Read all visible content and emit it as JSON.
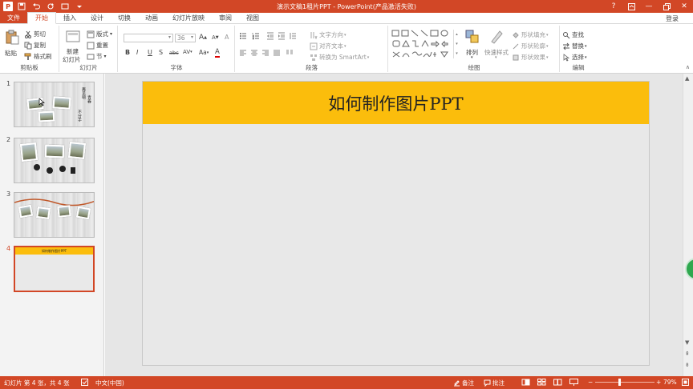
{
  "window": {
    "title": "演示文稿1租片PPT - PowerPoint(产品激活失败)",
    "login": "登录",
    "controls": [
      "?",
      "▢",
      "—",
      "▢",
      "✕"
    ]
  },
  "qat": {
    "app_letter": "P",
    "save": "💾",
    "undo": "↶",
    "redo": "↻",
    "present": "▤"
  },
  "tabs": [
    "文件",
    "开始",
    "插入",
    "设计",
    "切换",
    "动画",
    "幻灯片放映",
    "审阅",
    "视图"
  ],
  "active_tab": "开始",
  "ribbon": {
    "clipboard": {
      "paste": "粘贴",
      "cut": "剪切",
      "copy": "复制",
      "format_painter": "格式刷",
      "label": "剪贴板"
    },
    "slides": {
      "new_slide_line1": "新建",
      "new_slide_line2": "幻灯片",
      "layout": "版式",
      "reset": "重置",
      "section": "节",
      "label": "幻灯片"
    },
    "font": {
      "font_name": "",
      "font_size": "36",
      "grow": "A",
      "shrink": "A",
      "clear": "A",
      "bold": "B",
      "italic": "I",
      "underline": "U",
      "shadow": "S",
      "strike": "abc",
      "spacing": "AV",
      "case": "Aa",
      "color": "A",
      "label": "字体"
    },
    "paragraph": {
      "text_direction": "文字方向",
      "align_text": "对齐文本",
      "smartart": "转换为 SmartArt",
      "label": "段落"
    },
    "drawing": {
      "arrange": "排列",
      "quick_styles": "快速样式",
      "shape_fill": "形状填充",
      "shape_outline": "形状轮廓",
      "shape_effects": "形状效果",
      "label": "绘图"
    },
    "editing": {
      "find": "查找",
      "replace": "替换",
      "select": "选择",
      "label": "编辑"
    }
  },
  "slides": [
    {
      "number": "1",
      "tiny_text": [
        "再见吧",
        "青春",
        "不分手"
      ]
    },
    {
      "number": "2"
    },
    {
      "number": "3"
    },
    {
      "number": "4",
      "tiny_title": "如何制作图片PPT"
    }
  ],
  "selected_slide": "4",
  "current_slide": {
    "title": "如何制作图片PPT",
    "header_color": "#fbbd0c"
  },
  "status": {
    "slide_info": "幻灯片 第 4 张，共 4 张",
    "language": "中文(中国)",
    "notes": "备注",
    "comments": "批注",
    "zoom": "79%"
  },
  "colors": {
    "accent": "#d24726",
    "slide_header": "#fbbd0c"
  }
}
